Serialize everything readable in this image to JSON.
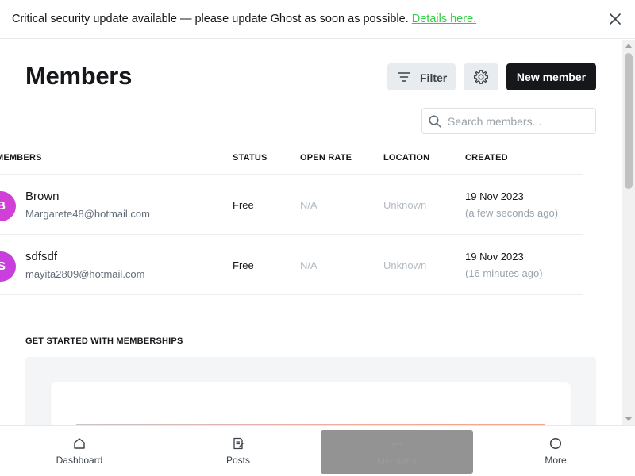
{
  "banner": {
    "message": "Critical security update available — please update Ghost as soon as possible.",
    "link_label": "Details here."
  },
  "header": {
    "title": "Members",
    "filter_label": "Filter",
    "new_member_label": "New member"
  },
  "search": {
    "placeholder": "Search members...",
    "value": ""
  },
  "table": {
    "columns": [
      "MEMBERS",
      "STATUS",
      "OPEN RATE",
      "LOCATION",
      "CREATED"
    ],
    "rows": [
      {
        "initial": "B",
        "avatar_color": "#d03fd6",
        "name": "Brown",
        "email": "Margarete48@hotmail.com",
        "status": "Free",
        "open_rate": "N/A",
        "location": "Unknown",
        "created": "19 Nov 2023",
        "created_ago": "(a few seconds ago)"
      },
      {
        "initial": "S",
        "avatar_color": "#c93fde",
        "name": "sdfsdf",
        "email": "mayita2809@hotmail.com",
        "status": "Free",
        "open_rate": "N/A",
        "location": "Unknown",
        "created": "19 Nov 2023",
        "created_ago": "(16 minutes ago)"
      }
    ]
  },
  "get_started": {
    "heading": "GET STARTED WITH MEMBERSHIPS"
  },
  "bottom_nav": {
    "items": [
      {
        "label": "Dashboard",
        "icon": "home-icon"
      },
      {
        "label": "Posts",
        "icon": "posts-icon"
      },
      {
        "label": "Members",
        "icon": "members-icon"
      },
      {
        "label": "More",
        "icon": "more-icon"
      }
    ]
  },
  "colors": {
    "accent_link": "#30cf43",
    "primary_button": "#15171a",
    "secondary_button": "#e9ecee"
  }
}
